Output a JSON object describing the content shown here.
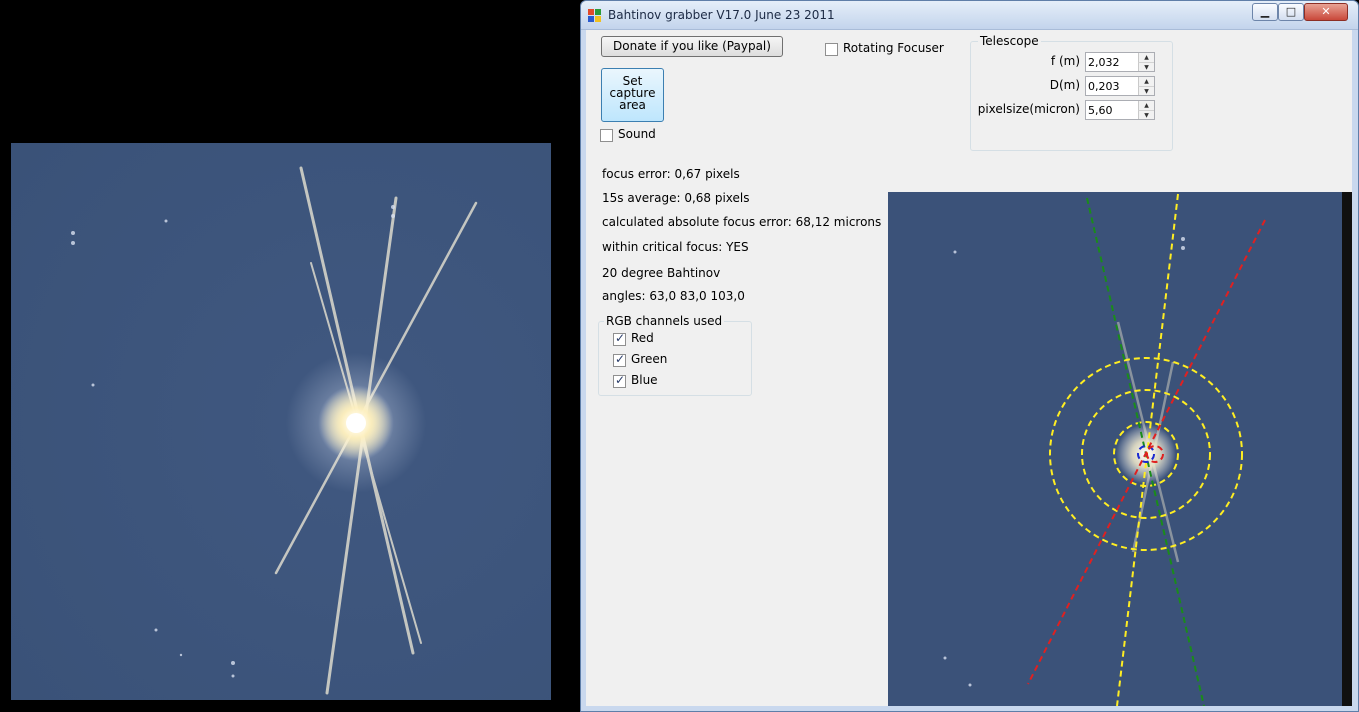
{
  "window": {
    "title": "Bahtinov grabber  V17.0 June 23 2011",
    "minimize_glyph": "▁",
    "maximize_glyph": "□",
    "close_glyph": "✕"
  },
  "buttons": {
    "donate": "Donate if you like (Paypal)",
    "capture_line1": "Set",
    "capture_line2": "capture",
    "capture_line3": "area"
  },
  "options": {
    "rotating_focuser": {
      "label": "Rotating Focuser",
      "checked": false
    },
    "sound": {
      "label": "Sound",
      "checked": false
    }
  },
  "telescope": {
    "group_label": "Telescope",
    "focal_length": {
      "label": "f (m)",
      "value": "2,032"
    },
    "diameter": {
      "label": "D(m)",
      "value": "0,203"
    },
    "pixelsize": {
      "label": "pixelsize(micron)",
      "value": "5,60"
    }
  },
  "results": {
    "focus_error": "focus error: 0,67 pixels",
    "average": "15s average: 0,68 pixels",
    "absolute_error": "calculated absolute focus error: 68,12 microns",
    "critical_focus": "within critical focus: YES",
    "mask_type": "20 degree Bahtinov",
    "angles": "angles: 63,0 83,0 103,0"
  },
  "rgb_channels": {
    "group_label": "RGB channels used",
    "red": {
      "label": "Red",
      "checked": true
    },
    "green": {
      "label": "Green",
      "checked": true
    },
    "blue": {
      "label": "Blue",
      "checked": true
    }
  },
  "colors": {
    "sky": "#3b5279",
    "guide_yellow": "#ffee22",
    "guide_red": "#e02020",
    "guide_green": "#1a8c1a",
    "guide_blue": "#1a2ad0"
  }
}
